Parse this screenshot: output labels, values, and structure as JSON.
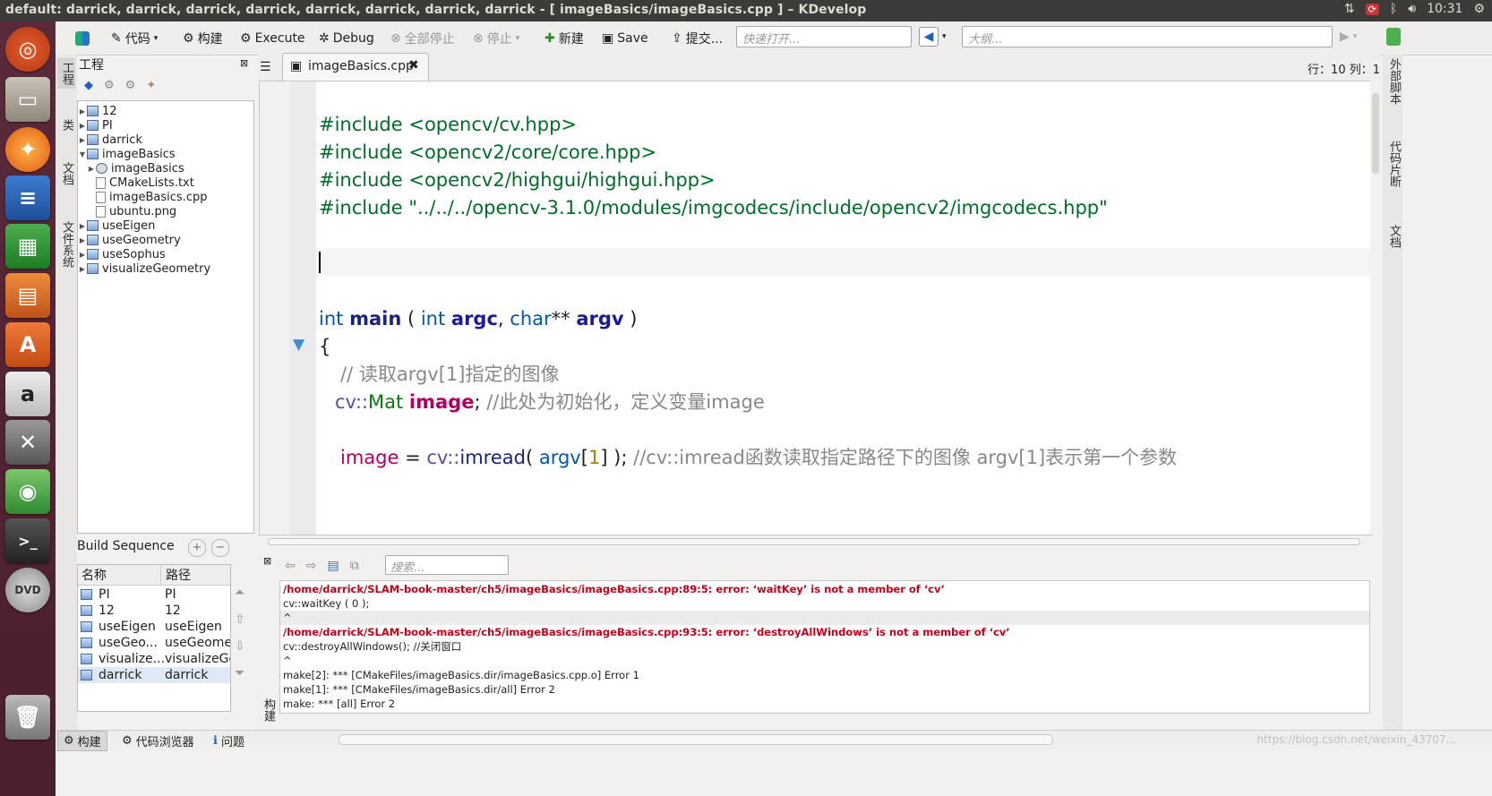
{
  "window": {
    "title": "default:  darrick, darrick, darrick, darrick, darrick, darrick, darrick, darrick - [ imageBasics/imageBasics.cpp ] – KDevelop",
    "clock": "10:31"
  },
  "launcher": {
    "items": [
      "ubuntu-logo-icon",
      "file-manager-icon",
      "firefox-icon",
      "writer-icon",
      "calc-icon",
      "impress-icon",
      "software-center-icon",
      "amazon-icon",
      "system-settings-icon",
      "kdevelop-icon",
      "terminal-icon",
      "dvd-icon",
      "trash-icon"
    ]
  },
  "toolbar": {
    "code_label": "代码",
    "build_label": "构建",
    "execute_label": "Execute",
    "debug_label": "Debug",
    "stop_all_label": "全部停止",
    "stop_label": "停止",
    "new_label": "新建",
    "save_label": "Save",
    "commit_label": "提交...",
    "quick_open_placeholder": "快速打开...",
    "outline_placeholder": "大纲..."
  },
  "left_tabs": [
    "工程",
    "类",
    "文档",
    "文件系统"
  ],
  "right_tabs": [
    "外部脚本",
    "代码片断",
    "文档"
  ],
  "project_panel": {
    "title": "工程",
    "tree": [
      {
        "label": "12",
        "type": "folder",
        "level": 0,
        "expanded": false
      },
      {
        "label": "PI",
        "type": "folder",
        "level": 0,
        "expanded": false
      },
      {
        "label": "darrick",
        "type": "folder",
        "level": 0,
        "expanded": false
      },
      {
        "label": "imageBasics",
        "type": "folder",
        "level": 0,
        "expanded": true
      },
      {
        "label": "imageBasics",
        "type": "target",
        "level": 1,
        "expanded": false
      },
      {
        "label": "CMakeLists.txt",
        "type": "file",
        "level": 1
      },
      {
        "label": "imageBasics.cpp",
        "type": "file",
        "level": 1
      },
      {
        "label": "ubuntu.png",
        "type": "file",
        "level": 1
      },
      {
        "label": "useEigen",
        "type": "folder",
        "level": 0,
        "expanded": false
      },
      {
        "label": "useGeometry",
        "type": "folder",
        "level": 0,
        "expanded": false
      },
      {
        "label": "useSophus",
        "type": "folder",
        "level": 0,
        "expanded": false
      },
      {
        "label": "visualizeGeometry",
        "type": "folder",
        "level": 0,
        "expanded": false
      }
    ]
  },
  "build_sequence": {
    "title": "Build Sequence",
    "columns": [
      "名称",
      "路径"
    ],
    "rows": [
      {
        "name": "PI",
        "path": "PI"
      },
      {
        "name": "12",
        "path": "12"
      },
      {
        "name": "useEigen",
        "path": "useEigen"
      },
      {
        "name": "useGeo...",
        "path": "useGeomet"
      },
      {
        "name": "visualize...",
        "path": "visualizeGe"
      },
      {
        "name": "darrick",
        "path": "darrick"
      }
    ]
  },
  "editor": {
    "tab_label": "imageBasics.cpp",
    "cursor_position": "行：10 列：1",
    "lines": {
      "l1": "#include <opencv/cv.hpp>",
      "l2": "#include <opencv2/core/core.hpp>",
      "l3": "#include <opencv2/highgui/highgui.hpp>",
      "l4": "#include \"../../../opencv-3.1.0/modules/imgcodecs/include/opencv2/imgcodecs.hpp\"",
      "main_int": "int",
      "main_name": "main",
      "main_open": " ( ",
      "main_int2": "int",
      "main_argc": "argc",
      "main_comma": ", ",
      "main_char": "char",
      "main_stars": "** ",
      "main_argv": "argv",
      "main_close": " )",
      "brace": "{",
      "comment1": "// 读取argv[1]指定的图像",
      "mat_ns": "cv::",
      "mat_cls": "Mat",
      "mat_var": "image",
      "mat_semi": ";",
      "mat_comment": "//此处为初始化，定义变量image",
      "imread_var": "image",
      "imread_eq": " = ",
      "imread_ns": "cv::",
      "imread_fn": "imread",
      "imread_open": "( ",
      "imread_argv": "argv",
      "imread_lb": "[",
      "imread_num": "1",
      "imread_rb": "] );",
      "imread_comment": "//cv::imread函数读取指定路径下的图像    argv[1]表示第一个参数"
    }
  },
  "output": {
    "search_placeholder": "搜索...",
    "lines": [
      {
        "text": "/home/darrick/SLAM-book-master/ch5/imageBasics/imageBasics.cpp:89:5: error: ‘waitKey’ is not a member of ‘cv’",
        "kind": "error"
      },
      {
        "text": "    cv::waitKey ( 0 );",
        "kind": "plain"
      },
      {
        "text": "    ^",
        "kind": "plain"
      },
      {
        "text": "/home/darrick/SLAM-book-master/ch5/imageBasics/imageBasics.cpp:93:5: error: ‘destroyAllWindows’ is not a member of ‘cv’",
        "kind": "error"
      },
      {
        "text": "    cv::destroyAllWindows();   //关闭窗口",
        "kind": "plain"
      },
      {
        "text": "    ^",
        "kind": "plain"
      },
      {
        "text": "make[2]: *** [CMakeFiles/imageBasics.dir/imageBasics.cpp.o] Error 1",
        "kind": "plain"
      },
      {
        "text": "make[1]: *** [CMakeFiles/imageBasics.dir/all] Error 2",
        "kind": "plain"
      },
      {
        "text": "make: *** [all] Error 2",
        "kind": "plain"
      }
    ],
    "side_label": "构建"
  },
  "bottom_tabs": {
    "build": "构建",
    "code_browser": "代码浏览器",
    "problems": "问题"
  },
  "watermark": "https://blog.csdn.net/weixin_43707..."
}
